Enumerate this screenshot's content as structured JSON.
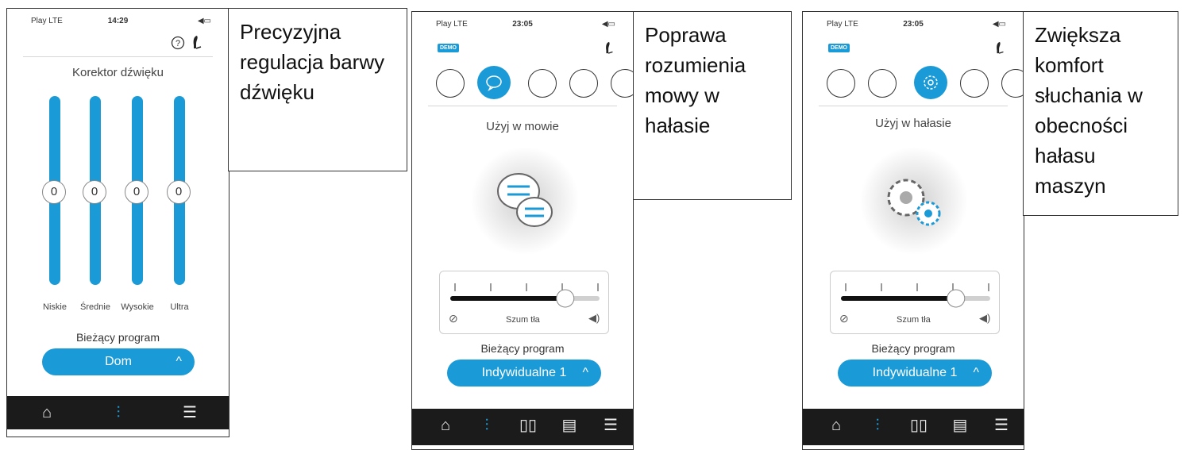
{
  "panels": [
    {
      "status": {
        "carrier": "Play LTE",
        "time": "14:29"
      },
      "screen_title": "Korektor dźwięku",
      "bands": [
        {
          "label": "Niskie",
          "value": "0"
        },
        {
          "label": "Średnie",
          "value": "0"
        },
        {
          "label": "Wysokie",
          "value": "0"
        },
        {
          "label": "Ultra",
          "value": "0"
        }
      ],
      "program_label": "Bieżący program",
      "program_value": "Dom",
      "chevron": "^",
      "caption": "Precyzyjna regulacja barwy dźwięku"
    },
    {
      "status": {
        "carrier": "Play LTE",
        "time": "23:05"
      },
      "demo": "DEMO",
      "screen_title": "Użyj w mowie",
      "noise_label": "Szum tła",
      "noise_level": 0.77,
      "program_label": "Bieżący program",
      "program_value": "Indywidualne 1",
      "chevron": "^",
      "caption": "Poprawa rozumienia mowy w hałasie"
    },
    {
      "status": {
        "carrier": "Play LTE",
        "time": "23:05"
      },
      "demo": "DEMO",
      "screen_title": "Użyj w hałasie",
      "noise_label": "Szum tła",
      "noise_level": 0.77,
      "program_label": "Bieżący program",
      "program_value": "Indywidualne 1",
      "chevron": "^",
      "caption": "Zwiększa komfort słuchania w obecności hałasu maszyn"
    }
  ],
  "icons": {
    "help": "help-icon",
    "hearing_aid": "hearing-aid-icon",
    "home": "home-icon",
    "equalizer": "equalizer-icon",
    "stats": "stats-icon",
    "remote": "remote-icon",
    "menu": "menu-icon",
    "speech": "speech-icon",
    "noise": "noise-icon",
    "wind": "wind-icon",
    "mute": "mute-icon",
    "volume": "volume-icon"
  },
  "colors": {
    "accent": "#1a9ad6",
    "tabbar": "#1b1b1b"
  }
}
